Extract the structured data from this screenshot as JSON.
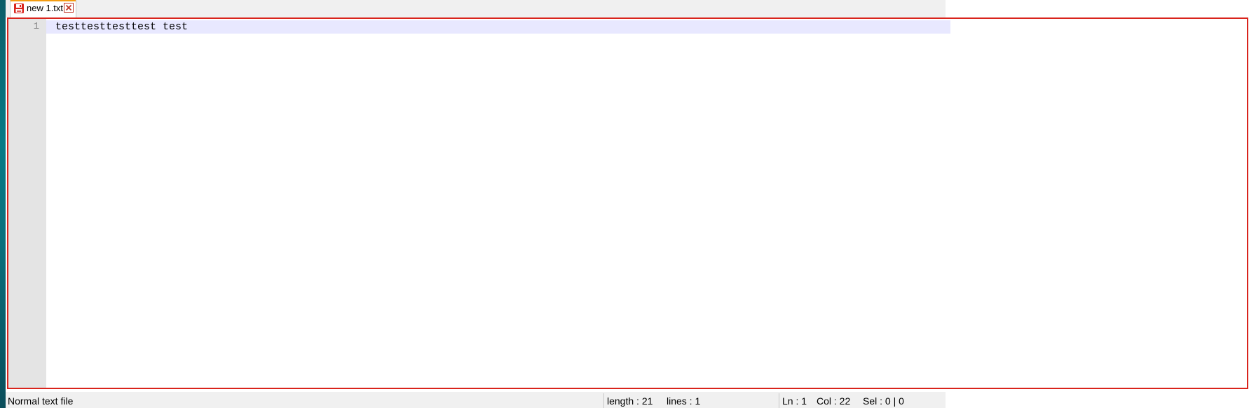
{
  "tabs": [
    {
      "label": "new 1.txt",
      "icon": "save-floppy-icon",
      "close_icon": "close-icon",
      "accent_color": "#f39c12"
    }
  ],
  "editor": {
    "line_numbers": [
      "1"
    ],
    "lines": [
      "testtesttesttest test"
    ],
    "current_line_color": "#e8e8ff",
    "highlight_border_color": "#d9241c"
  },
  "statusbar": {
    "file_type": "Normal text file",
    "length": "length : 21",
    "lines": "lines : 1",
    "ln": "Ln : 1",
    "col": "Col : 22",
    "sel": "Sel : 0 | 0"
  }
}
